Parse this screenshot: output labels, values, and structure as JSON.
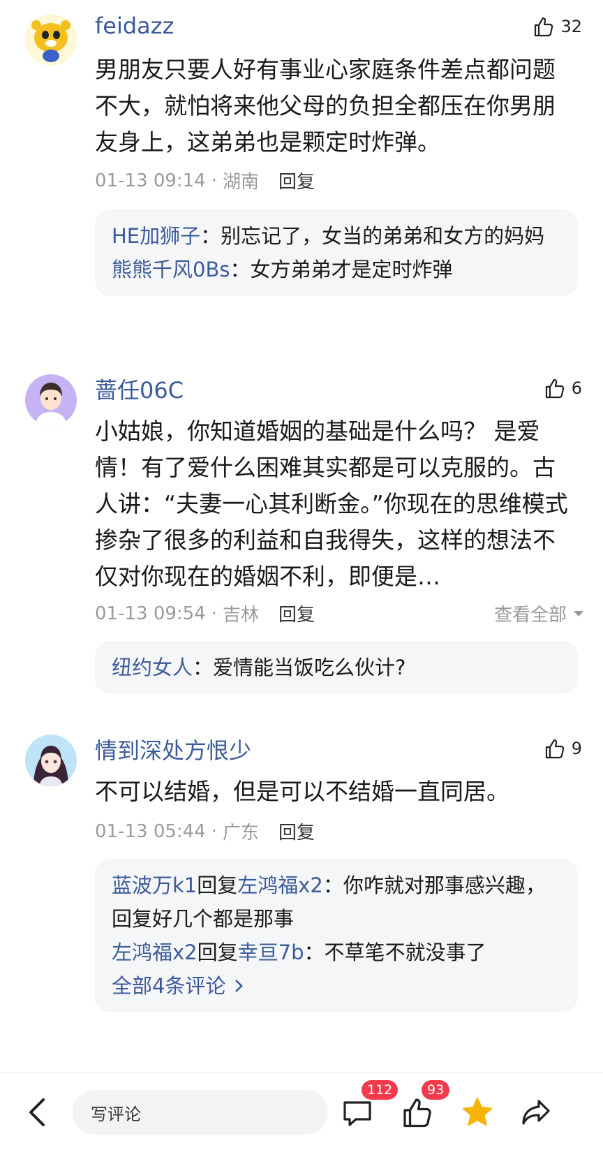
{
  "comments": [
    {
      "username": "feidazz",
      "likes": "32",
      "text": "男朋友只要人好有事业心家庭条件差点都问题不大，就怕将来他父母的负担全都压在你男朋友身上，这弟弟也是颗定时炸弹。",
      "time": "01-13 09:14",
      "location": "湖南",
      "reply_label": "回复",
      "replies": [
        {
          "name": "HE加狮子",
          "text": "：别忘记了，女当的弟弟和女方的妈妈"
        },
        {
          "name": "熊熊千风0Bs",
          "text": "：女方弟弟才是定时炸弹"
        }
      ]
    },
    {
      "username": "蔷任06C",
      "likes": "6",
      "text": "小姑娘，你知道婚姻的基础是什么吗？ 是爱情！有了爱什么困难其实都是可以克服的。古人讲：“夫妻一心其利断金。”你现在的思维模式掺杂了很多的利益和自我得失，这样的想法不仅对你现在的婚姻不利，即便是…",
      "time": "01-13 09:54",
      "location": "吉林",
      "reply_label": "回复",
      "expand_label": "查看全部",
      "replies": [
        {
          "name": "纽约女人",
          "text": "：爱情能当饭吃么伙计?"
        }
      ]
    },
    {
      "username": "情到深处方恨少",
      "likes": "9",
      "text": "不可以结婚，但是可以不结婚一直同居。",
      "time": "01-13 05:44",
      "location": "广东",
      "reply_label": "回复",
      "replies": [
        {
          "name": "蓝波万k1",
          "mid": "回复",
          "name2": "左鸿福x2",
          "text": "：你咋就对那事感兴趣，回复好几个都是那事"
        },
        {
          "name": "左鸿福x2",
          "mid": "回复",
          "name2": "幸亘7b",
          "text": "：不草笔不就没事了"
        }
      ],
      "more_label": "全部4条评论"
    }
  ],
  "bottom_bar": {
    "input_placeholder": "写评论",
    "comment_count": "112",
    "like_count": "93"
  },
  "colors": {
    "name_blue": "#3c5b9b",
    "badge_red": "#f23a4b",
    "star_yellow": "#f5b400"
  }
}
